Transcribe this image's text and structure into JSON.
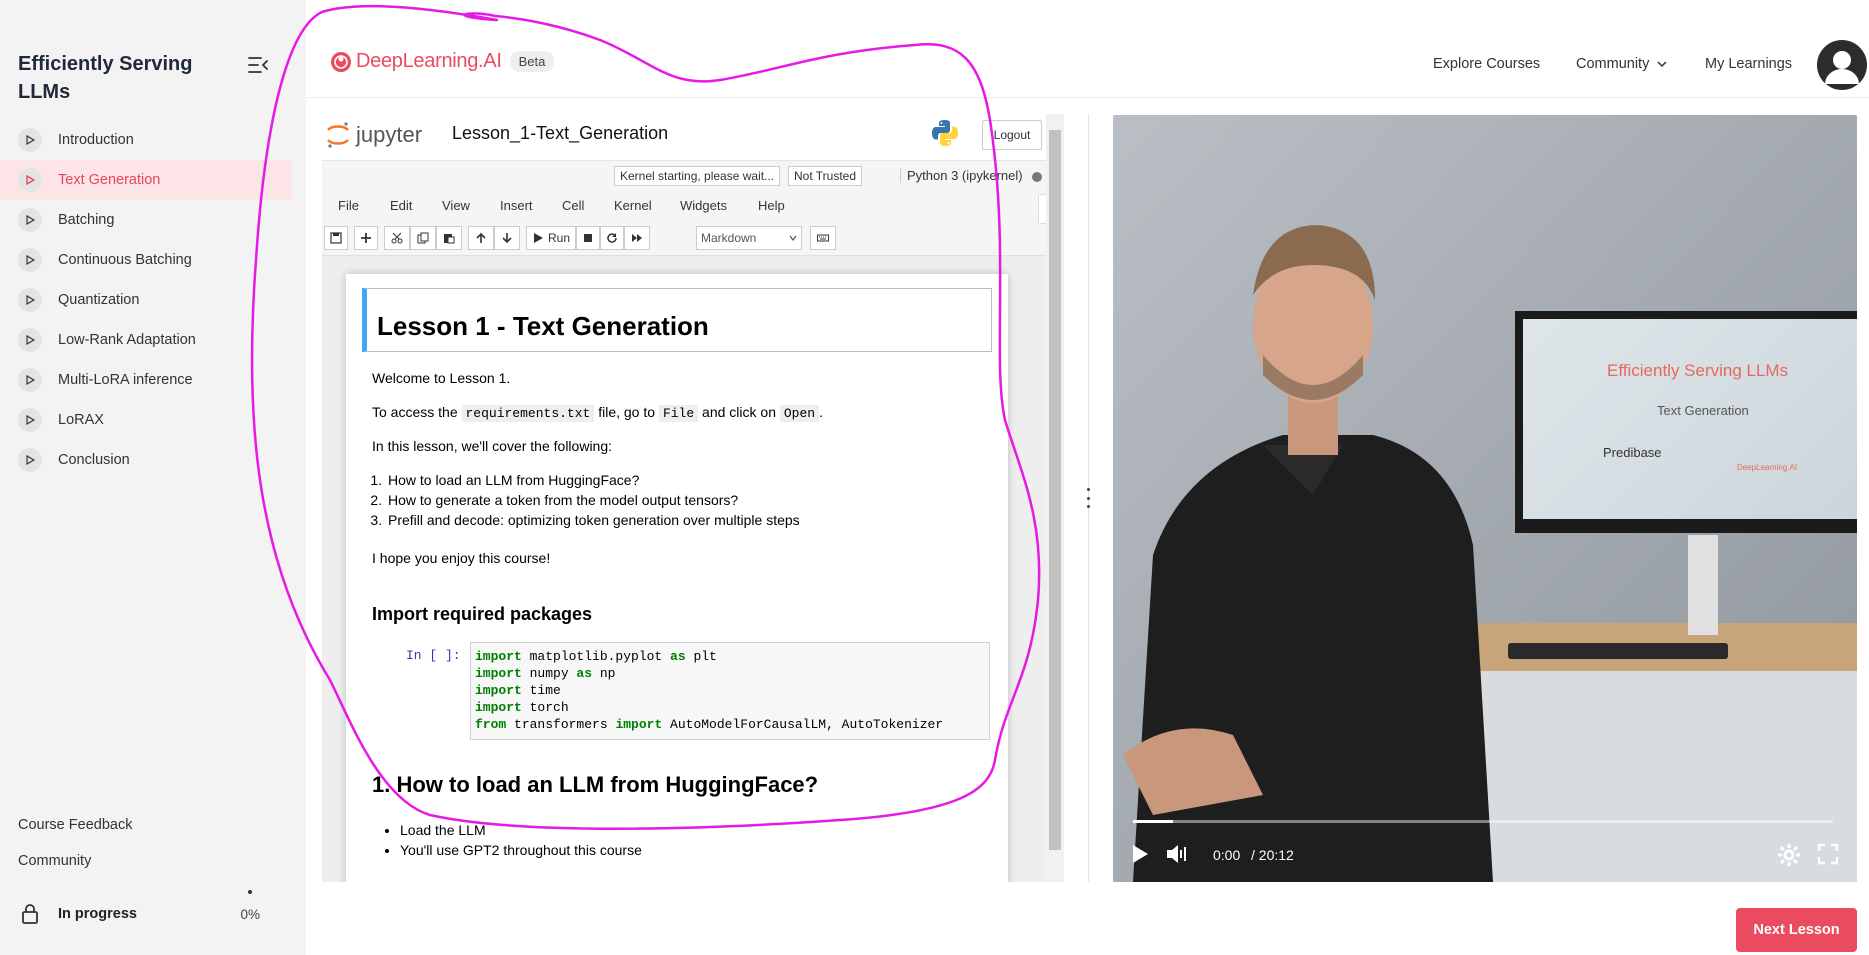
{
  "sidebar": {
    "course_title": "Efficiently Serving LLMs",
    "lessons": [
      {
        "label": "Introduction"
      },
      {
        "label": "Text Generation"
      },
      {
        "label": "Batching"
      },
      {
        "label": "Continuous Batching"
      },
      {
        "label": "Quantization"
      },
      {
        "label": "Low-Rank Adaptation"
      },
      {
        "label": "Multi-LoRA inference"
      },
      {
        "label": "LoRAX"
      },
      {
        "label": "Conclusion"
      }
    ],
    "active_lesson": "Text Generation",
    "course_feedback": "Course Feedback",
    "community": "Community",
    "status": "In progress",
    "progress": "0%"
  },
  "topnav": {
    "logo_text": "DeepLearning.AI",
    "beta": "Beta",
    "explore": "Explore Courses",
    "community": "Community",
    "my_learnings": "My Learnings"
  },
  "jupyter": {
    "logo_text": "jupyter",
    "notebook_name": "Lesson_1-Text_Generation",
    "logout": "Logout",
    "kernel_status": "Kernel starting, please wait...",
    "trust": "Not Trusted",
    "kernel_name": "Python 3 (ipykernel)",
    "menu": [
      "File",
      "Edit",
      "View",
      "Insert",
      "Cell",
      "Kernel",
      "Widgets",
      "Help"
    ],
    "run_label": "Run",
    "cell_type": "Markdown",
    "notebook": {
      "title": "Lesson 1 - Text Generation",
      "welcome": "Welcome to Lesson 1.",
      "access_pre": "To access the",
      "access_code1": "requirements.txt",
      "access_mid": "file, go to",
      "access_code2": "File",
      "access_mid2": "and click on",
      "access_code3": "Open",
      "access_end": ".",
      "cover": "In this lesson, we'll cover the following:",
      "list": [
        "How to load an LLM from HuggingFace?",
        "How to generate a token from the model output tensors?",
        "Prefill and decode: optimizing token generation over multiple steps"
      ],
      "enjoy": "I hope you enjoy this course!",
      "h_import": "Import required packages",
      "in_prompt": "In [ ]:",
      "code": [
        {
          "kw": "import",
          "rest": " matplotlib.pyplot ",
          "kw2": "as",
          "rest2": " plt"
        },
        {
          "kw": "import",
          "rest": " numpy ",
          "kw2": "as",
          "rest2": " np"
        },
        {
          "kw": "import",
          "rest": " time",
          "kw2": "",
          "rest2": ""
        },
        {
          "kw": "import",
          "rest": " torch",
          "kw2": "",
          "rest2": ""
        },
        {
          "kw": "from",
          "rest": " transformers ",
          "kw2": "import",
          "rest2": " AutoModelForCausalLM, AutoTokenizer"
        }
      ],
      "h_load": "1. How to load an LLM from HuggingFace?",
      "bullets": [
        "Load the LLM",
        "You'll use GPT2 throughout this course"
      ]
    }
  },
  "video": {
    "slide_title": "Efficiently Serving LLMs",
    "slide_subtitle": "Text Generation",
    "slide_logo1": "Predibase",
    "slide_logo2": "DeepLearning.AI",
    "time_current": "0:00",
    "time_total": "/ 20:12",
    "progress_fraction": 0.0
  },
  "next_lesson": "Next Lesson",
  "colors": {
    "brand": "#ea4b5f",
    "active_bg": "#fde4e6",
    "annotation": "#e619e6"
  }
}
